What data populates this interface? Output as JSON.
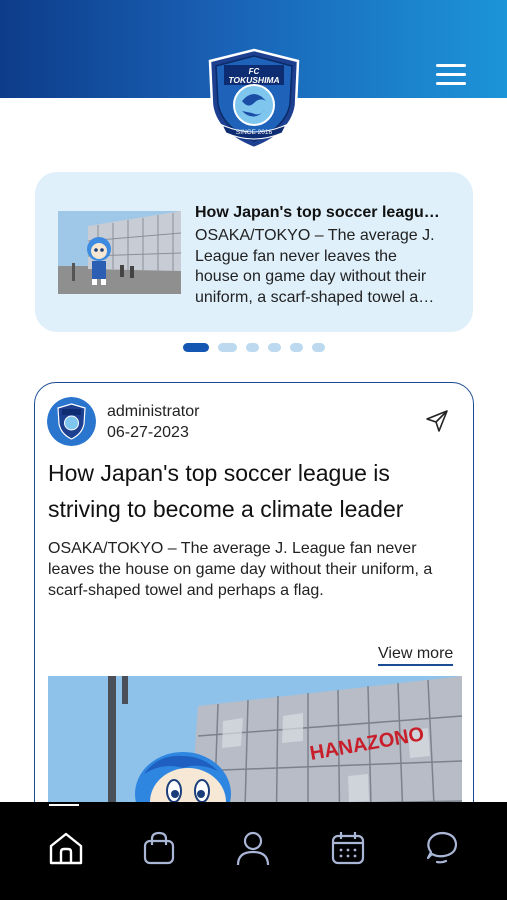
{
  "colors": {
    "brand_dark": "#0d3c8a",
    "brand_light": "#1c94d8",
    "carousel_bg": "#dff0fb",
    "card_border": "#1a4c95",
    "tabbar_bg": "#000000"
  },
  "header": {
    "logo_icon": "fc-tokushima-crest-icon",
    "menu_icon": "hamburger-menu-icon"
  },
  "carousel": {
    "title": "How Japan's top soccer league is striving to become a climate leader",
    "description": "OSAKA/TOKYO – The average J. League fan never leaves the house on game day without their uniform, a scarf-shaped towel and perhaps a flag.",
    "slide_count": 6,
    "active_index": 0
  },
  "post": {
    "author": "administrator",
    "date": "06-27-2023",
    "title": "How Japan's top soccer league is striving to become a climate leader",
    "body": "OSAKA/TOKYO – The average J. League fan never leaves the house on game day without their uniform, a scarf-shaped towel and perhaps a flag.",
    "view_more": "View more",
    "share_icon": "share-send-icon"
  },
  "tabbar": {
    "tabs": [
      {
        "icon": "home-icon",
        "active": true
      },
      {
        "icon": "shopping-bag-icon",
        "active": false
      },
      {
        "icon": "profile-icon",
        "active": false
      },
      {
        "icon": "calendar-icon",
        "active": false
      },
      {
        "icon": "chat-icon",
        "active": false
      }
    ]
  }
}
